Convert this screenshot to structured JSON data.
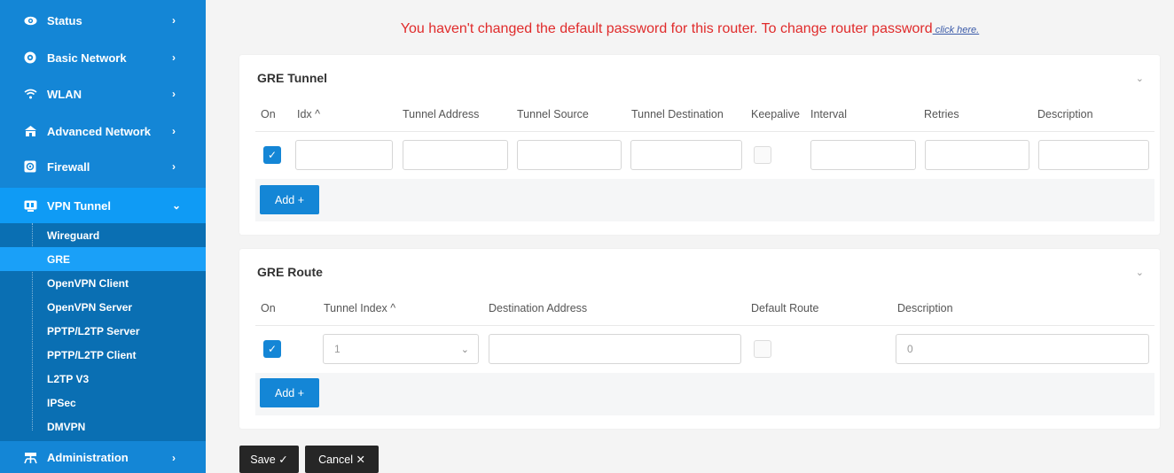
{
  "sidebar": {
    "items": [
      {
        "label": "Status",
        "icon": "eye-icon"
      },
      {
        "label": "Basic Network",
        "icon": "globe-icon"
      },
      {
        "label": "WLAN",
        "icon": "wifi-icon"
      },
      {
        "label": "Advanced Network",
        "icon": "network-icon"
      },
      {
        "label": "Firewall",
        "icon": "firewall-icon"
      },
      {
        "label": "VPN Tunnel",
        "icon": "vpn-icon"
      },
      {
        "label": "Administration",
        "icon": "admin-icon"
      }
    ],
    "vpn_submenu": [
      "Wireguard",
      "GRE",
      "OpenVPN Client",
      "OpenVPN Server",
      "PPTP/L2TP Server",
      "PPTP/L2TP Client",
      "L2TP V3",
      "IPSec",
      "DMVPN"
    ],
    "active_sub": "GRE"
  },
  "warning": {
    "text": "You haven't changed the default password for this router. To change router password",
    "link": " click here."
  },
  "gre_tunnel": {
    "title": "GRE Tunnel",
    "columns": [
      "On",
      "Idx ^",
      "Tunnel Address",
      "Tunnel Source",
      "Tunnel Destination",
      "Keepalive",
      "Interval",
      "Retries",
      "Description"
    ],
    "row": {
      "on": true,
      "keepalive": false,
      "idx": "",
      "tunnel_address": "",
      "tunnel_source": "",
      "tunnel_destination": "",
      "interval": "",
      "retries": "",
      "description": ""
    },
    "add_label": "Add +"
  },
  "gre_route": {
    "title": "GRE Route",
    "columns": [
      "On",
      "Tunnel Index ^",
      "Destination Address",
      "Default Route",
      "Description"
    ],
    "row": {
      "on": true,
      "tunnel_index": "1",
      "destination_address": "",
      "default_route": false,
      "description": "0"
    },
    "add_label": "Add +"
  },
  "actions": {
    "save": "Save ✓",
    "cancel": "Cancel ✕"
  },
  "colors": {
    "primary": "#1486d6",
    "warning": "#e02b2b",
    "submenu_bg": "#0a6fb3"
  }
}
